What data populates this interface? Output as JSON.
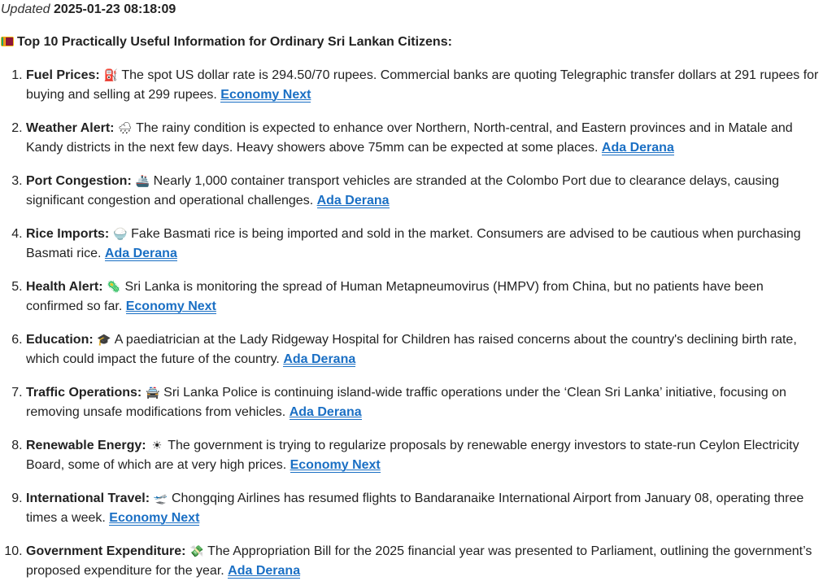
{
  "updated": {
    "label": "Updated",
    "timestamp": "2025-01-23 08:18:09"
  },
  "heading": "Top 10 Practically Useful Information for Ordinary Sri Lankan Citizens:",
  "items": [
    {
      "title": "Fuel Prices:",
      "icon": "⛽",
      "text": "The spot US dollar rate is 294.50/70 rupees. Commercial banks are quoting Telegraphic transfer dollars at 291 rupees for buying and selling at 299 rupees.",
      "source": "Economy Next"
    },
    {
      "title": "Weather Alert:",
      "icon": "🌧",
      "text": "The rainy condition is expected to enhance over Northern, North-central, and Eastern provinces and in Matale and Kandy districts in the next few days. Heavy showers above 75mm can be expected at some places.",
      "source": "Ada Derana"
    },
    {
      "title": "Port Congestion:",
      "icon": "🚢",
      "text": "Nearly 1,000 container transport vehicles are stranded at the Colombo Port due to clearance delays, causing significant congestion and operational challenges.",
      "source": "Ada Derana"
    },
    {
      "title": "Rice Imports:",
      "icon": "🍚",
      "text": "Fake Basmati rice is being imported and sold in the market. Consumers are advised to be cautious when purchasing Basmati rice.",
      "source": "Ada Derana"
    },
    {
      "title": "Health Alert:",
      "icon": "🦠",
      "text": "Sri Lanka is monitoring the spread of Human Metapneumovirus (HMPV) from China, but no patients have been confirmed so far.",
      "source": "Economy Next"
    },
    {
      "title": "Education:",
      "icon": "🎓",
      "text": "A paediatrician at the Lady Ridgeway Hospital for Children has raised concerns about the country's declining birth rate, which could impact the future of the country.",
      "source": "Ada Derana"
    },
    {
      "title": "Traffic Operations:",
      "icon": "🚔",
      "text": "Sri Lanka Police is continuing island-wide traffic operations under the ‘Clean Sri Lanka’ initiative, focusing on removing unsafe modifications from vehicles.",
      "source": "Ada Derana"
    },
    {
      "title": "Renewable Energy:",
      "icon": "☀",
      "text": "The government is trying to regularize proposals by renewable energy investors to state-run Ceylon Electricity Board, some of which are at very high prices.",
      "source": "Economy Next"
    },
    {
      "title": "International Travel:",
      "icon": "🛫",
      "text": "Chongqing Airlines has resumed flights to Bandaranaike International Airport from January 08, operating three times a week.",
      "source": "Economy Next"
    },
    {
      "title": "Government Expenditure:",
      "icon": "💸",
      "text": "The Appropriation Bill for the 2025 financial year was presented to Parliament, outlining the government’s proposed expenditure for the year.",
      "source": "Ada Derana"
    }
  ],
  "colors": {
    "link": "#1a6fc4",
    "text": "#222222"
  }
}
